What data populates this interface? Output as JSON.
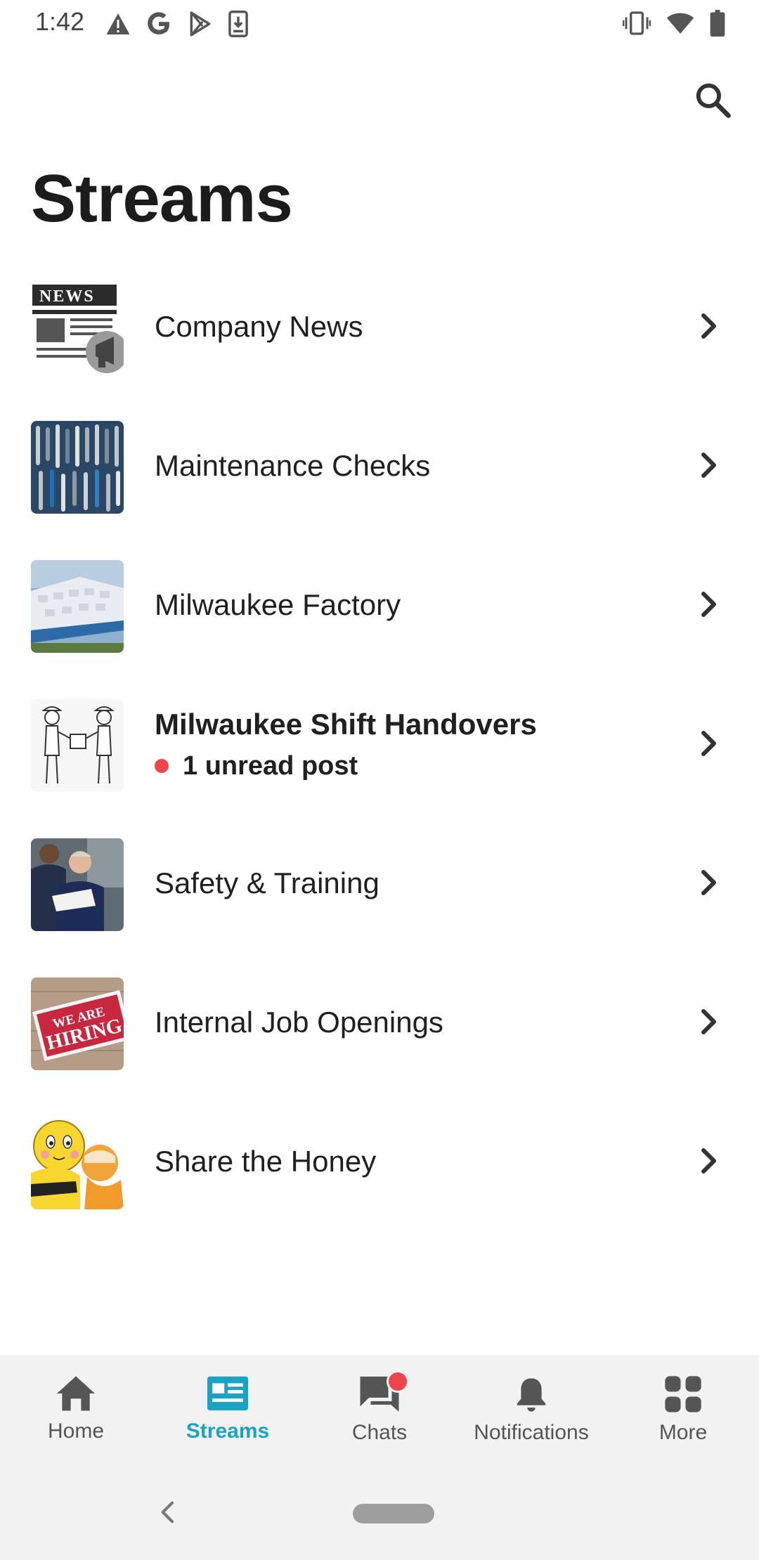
{
  "status_bar": {
    "time": "1:42",
    "left_icons": [
      "alert-icon",
      "google-icon",
      "play-store-icon",
      "download-icon"
    ],
    "right_icons": [
      "vibrate-icon",
      "wifi-icon",
      "battery-icon"
    ]
  },
  "header": {
    "title": "Streams",
    "search_icon": "search-icon"
  },
  "streams": [
    {
      "label": "Company News",
      "thumb": "news-thumb"
    },
    {
      "label": "Maintenance Checks",
      "thumb": "tools-thumb"
    },
    {
      "label": "Milwaukee Factory",
      "thumb": "factory-thumb"
    },
    {
      "label": "Milwaukee Shift Handovers",
      "thumb": "workers-thumb",
      "unread": "1 unread post"
    },
    {
      "label": "Safety & Training",
      "thumb": "training-thumb"
    },
    {
      "label": "Internal Job Openings",
      "thumb": "hiring-thumb",
      "thumb_text": [
        "WE ARE",
        "HIRING"
      ]
    },
    {
      "label": "Share the Honey",
      "thumb": "bee-thumb"
    }
  ],
  "bottom_nav": [
    {
      "label": "Home",
      "icon": "home-icon",
      "active": false
    },
    {
      "label": "Streams",
      "icon": "streams-icon",
      "active": true
    },
    {
      "label": "Chats",
      "icon": "chats-icon",
      "active": false,
      "badge": true
    },
    {
      "label": "Notifications",
      "icon": "bell-icon",
      "active": false
    },
    {
      "label": "More",
      "icon": "grid-icon",
      "active": false
    }
  ],
  "colors": {
    "accent": "#1aa3c4",
    "unread_dot": "#f0444d",
    "nav_background": "#f2f2f2"
  }
}
